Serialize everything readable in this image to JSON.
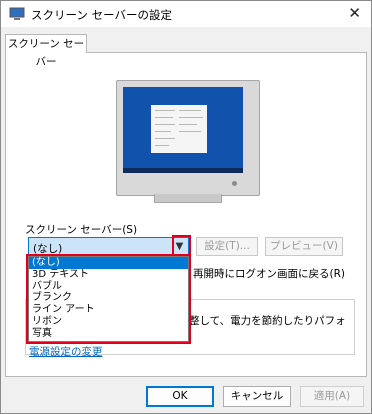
{
  "window": {
    "title": "スクリーン セーバーの設定",
    "close_glyph": "✕"
  },
  "tab": {
    "label": "スクリーン セーバー"
  },
  "screensaver": {
    "label": "スクリーン セーバー(S)",
    "selected": "(なし)",
    "settings_button": "設定(T)...",
    "preview_button": "プレビュー(V)",
    "options": [
      "(なし)",
      "3D テキスト",
      "バブル",
      "ブランク",
      "ライン アート",
      "リボン",
      "写真"
    ],
    "resume_text": "再開時にログオン画面に戻る(R)"
  },
  "power": {
    "text": "整して、電力を節約したりパフォ",
    "link": "電源設定の変更"
  },
  "buttons": {
    "ok": "OK",
    "cancel": "キャンセル",
    "apply": "適用(A)"
  },
  "colors": {
    "accent": "#0078d4",
    "highlight": "#e0001b",
    "screen": "#1152ad",
    "link": "#0066cc"
  }
}
